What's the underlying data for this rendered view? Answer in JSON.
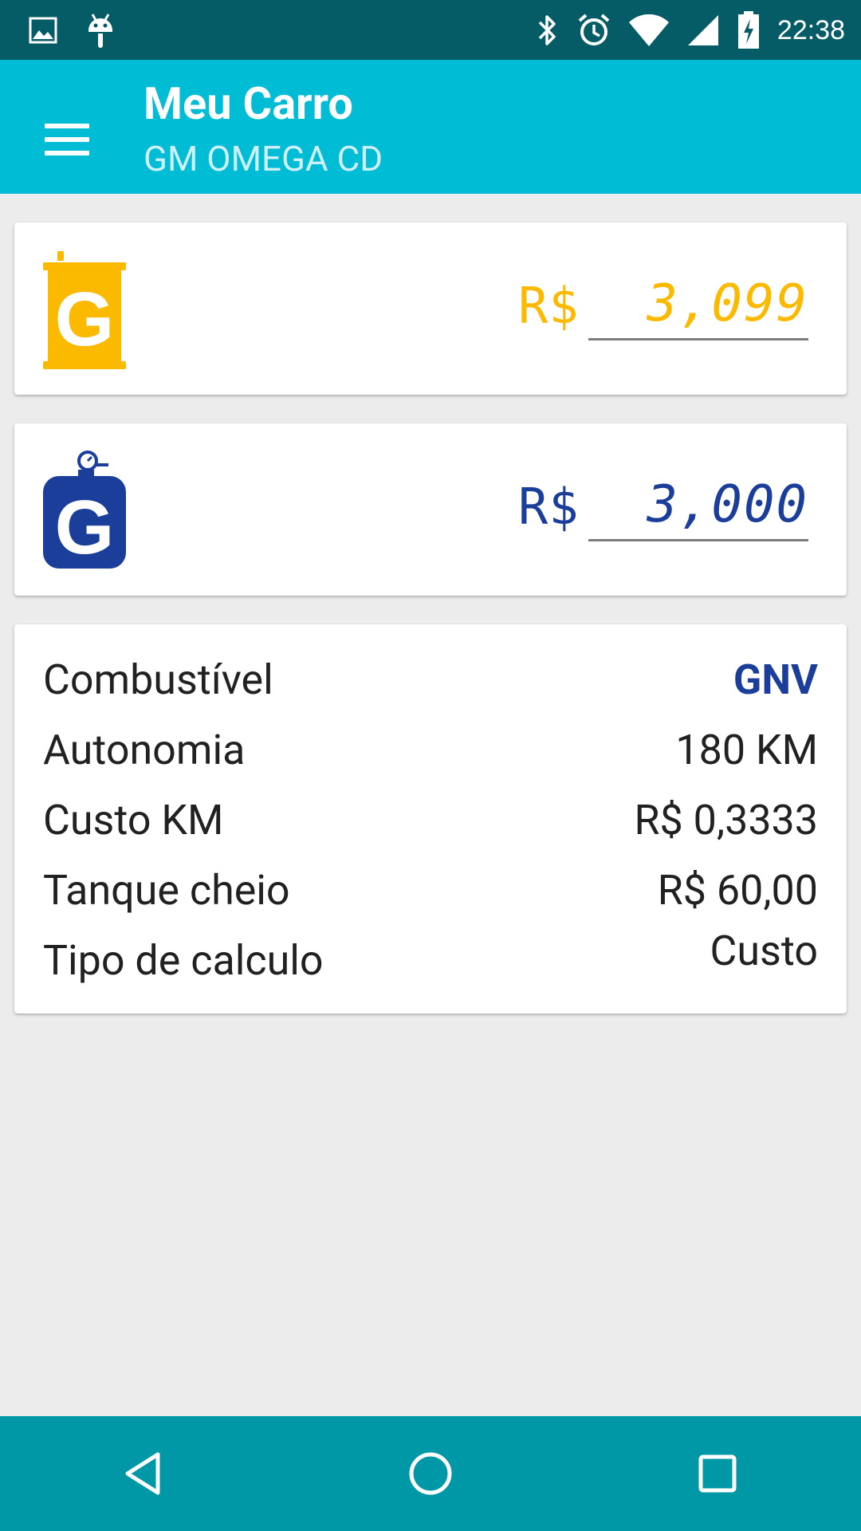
{
  "status_bar": {
    "time": "22:38",
    "icons": [
      "image-icon",
      "android-icon",
      "bluetooth-icon",
      "alarm-icon",
      "wifi-icon",
      "signal-icon",
      "battery-charging-icon"
    ]
  },
  "app_bar": {
    "title": "Meu Carro",
    "subtitle": "GM OMEGA CD",
    "menu_icon": "menu-icon"
  },
  "fuel_prices": [
    {
      "icon": "gasoline-can-icon",
      "letter": "G",
      "currency": "R$",
      "price": "3,099",
      "color": "#fbb900"
    },
    {
      "icon": "gas-cylinder-icon",
      "letter": "G",
      "currency": "R$",
      "price": "3,000",
      "color": "#1a3e99"
    }
  ],
  "summary": {
    "combustivel_label": "Combustível",
    "combustivel_value": "GNV",
    "autonomia_label": "Autonomia",
    "autonomia_value": "180 KM",
    "custo_km_label": "Custo KM",
    "custo_km_value": "R$ 0,3333",
    "tanque_label": "Tanque cheio",
    "tanque_value": "R$ 60,00",
    "tipo_label": "Tipo de calculo",
    "tipo_value": "Custo"
  },
  "nav_bar": {
    "back_icon": "back-icon",
    "home_icon": "home-icon",
    "recents_icon": "recents-icon"
  },
  "colors": {
    "status_bar": "#055c66",
    "app_bar": "#00bcd4",
    "nav_bar": "#0097a7",
    "gasoline": "#fbb900",
    "gnv": "#1a3e99"
  }
}
